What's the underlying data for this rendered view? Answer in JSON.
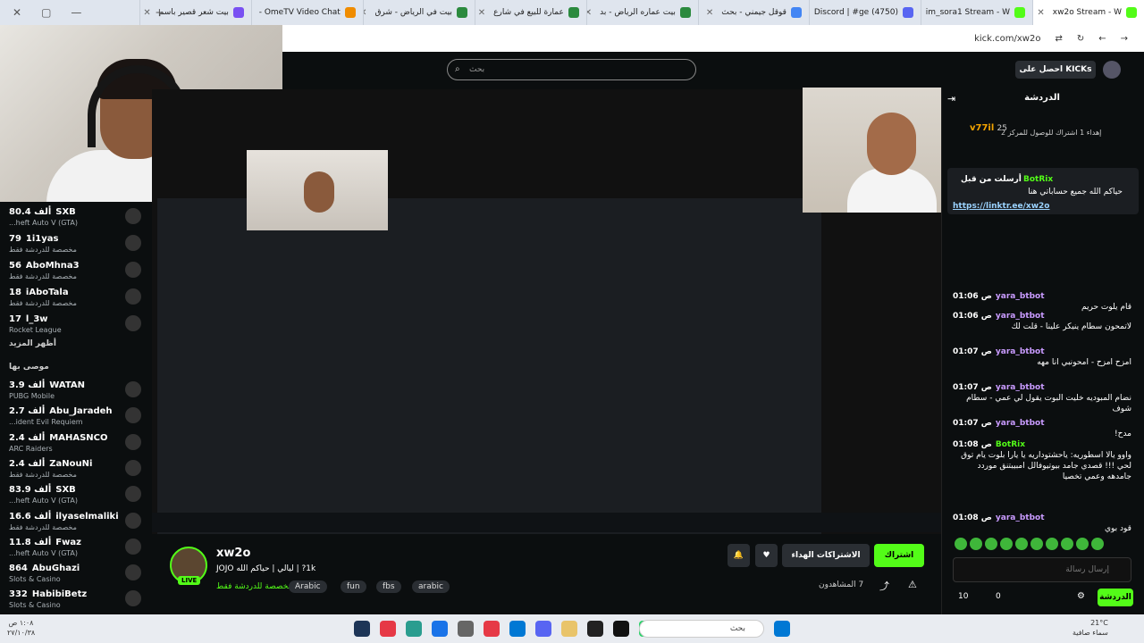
{
  "tabs": [
    {
      "title": "xw2o Stream - W",
      "color": "#53fc18",
      "active": true
    },
    {
      "title": "im_sora1 Stream - W",
      "color": "#53fc18"
    },
    {
      "title": "(4750) Discord | #ge",
      "color": "#5865f2"
    },
    {
      "title": "قوقل جيمني - بحث",
      "color": "#4285f4"
    },
    {
      "title": "بيت عماره الرياض - بد",
      "color": "#2b8a3e"
    },
    {
      "title": "عمارة للبيع في شارع",
      "color": "#2b8a3e"
    },
    {
      "title": "بيت في الرياض - شرق",
      "color": "#2b8a3e"
    },
    {
      "title": "OmeTV Video Chat -",
      "color": "#f08c00"
    },
    {
      "title": "بيت شعر قصير باسم",
      "color": "#7950f2"
    }
  ],
  "address": {
    "url": "kick.com/xw2o"
  },
  "search": {
    "placeholder": "بحث"
  },
  "kick_button": "احصل على KICKs",
  "sidebar": {
    "following": [
      {
        "name": "SXB",
        "count": "80.4 ألف",
        "category": "...heft Auto V (GTA)"
      },
      {
        "name": "1i1yas",
        "count": "79",
        "category": "مخصصة للدردشة فقط"
      },
      {
        "name": "AboMhna3",
        "count": "56",
        "category": "مخصصة للدردشة فقط"
      },
      {
        "name": "iAboTala",
        "count": "18",
        "category": "مخصصة للدردشة فقط"
      },
      {
        "name": "l_3w",
        "count": "17",
        "category": "Rocket League"
      }
    ],
    "show_more": "أظهر المزيد",
    "recommended_label": "موصى بها",
    "recommended": [
      {
        "name": "WATAN",
        "count": "3.9 ألف",
        "category": "PUBG Mobile"
      },
      {
        "name": "Abu_Jaradeh",
        "count": "2.7 ألف",
        "category": "...ident Evil Requiem"
      },
      {
        "name": "MAHASNCO",
        "count": "2.4 ألف",
        "category": "ARC Raiders"
      },
      {
        "name": "ZaNouNi",
        "count": "2.4 ألف",
        "category": "مخصصة للدردشة فقط"
      },
      {
        "name": "SXB",
        "count": "83.9 ألف",
        "category": "...heft Auto V (GTA)"
      },
      {
        "name": "ilyaselmaliki",
        "count": "16.6 ألف",
        "category": "مخصصة للدردشة فقط"
      },
      {
        "name": "Fwaz",
        "count": "11.8 ألف",
        "category": "...heft Auto V (GTA)"
      },
      {
        "name": "AbuGhazi",
        "count": "864",
        "category": "Slots & Casino"
      },
      {
        "name": "HabibiBetz",
        "count": "332",
        "category": "Slots & Casino"
      }
    ]
  },
  "channel": {
    "name": "xw2o",
    "title": "1k? | ليالي | حياكم الله JOJO",
    "category": "مخصصة للدردشة فقط",
    "live": "LIVE",
    "tags": [
      "Arabic",
      "fun",
      "fbs",
      "arabic"
    ],
    "viewers": "7 المشاهدون",
    "follow_label": "اشتراك",
    "subs_label": "الاشتراكات الهداء"
  },
  "chat": {
    "title": "الدردشة",
    "leader_name": "v77il",
    "leader_count": "25",
    "leader_text": "إهداء 1 اشتراك للوصول للمركز 2",
    "pinned": {
      "user": "BotRix",
      "sent_by": "أرسلت من قبل",
      "text": "حياكم الله جميع حساباتي هنا",
      "link": "https://linktr.ee/xw2o"
    },
    "messages": [
      {
        "time": "01:06 ص",
        "user": "yara_btbot",
        "text": "قام يلوت حريم"
      },
      {
        "time": "01:06 ص",
        "user": "yara_btbot",
        "text": "لاتمحون سطام ينيكر علينا - قلت لك"
      },
      {
        "time": "01:07 ص",
        "user": "yara_btbot",
        "text": "امزح امزح - امحونبي انا مهه"
      },
      {
        "time": "01:07 ص",
        "user": "yara_btbot",
        "text": "نضام المبوديه خليت البوت يقول لي عمي - سطام شوف"
      },
      {
        "time": "01:07 ص",
        "user": "yara_btbot",
        "text": "مدح!"
      },
      {
        "time": "01:08 ص",
        "user": "BotRix",
        "text": "واوو يالا اسطوريه: ياحشتوداريه يا يارا بلوت يام توق لحي !!! قصدي جامد بيوتيوفالل امبيبتنق موردد جامدهه وعمي تخصيا"
      },
      {
        "time": "01:08 ص",
        "user": "yara_btbot",
        "text": "قود بوي"
      }
    ],
    "input_placeholder": "إرسال رسالة",
    "send_label": "الدردشة",
    "stat1": "0",
    "stat2": "10"
  },
  "taskbar": {
    "search": "بحث",
    "time": "١:٠٨ ص",
    "date": "٢٧/١٠/٣٨",
    "weather": "21°C",
    "weather_desc": "سماء صافية"
  }
}
